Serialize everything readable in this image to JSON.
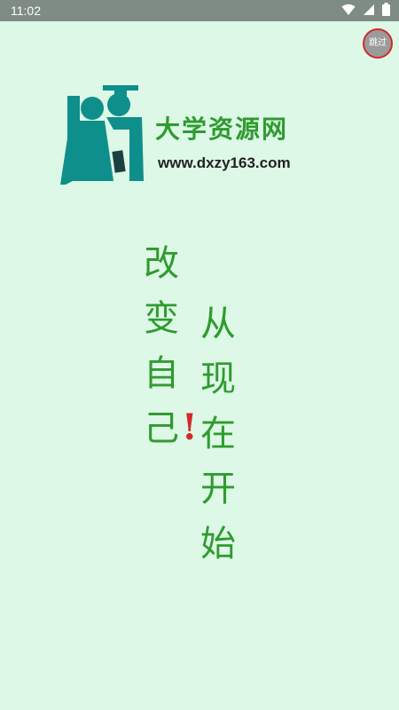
{
  "status_bar": {
    "time": "11:02",
    "icons": [
      "wifi-icon",
      "signal-icon",
      "battery-icon"
    ]
  },
  "skip_button": {
    "label": "跳过"
  },
  "brand": {
    "name": "大学资源网",
    "url": "www.dxzy163.com",
    "logo_colors": {
      "teal": "#0e8f8c",
      "dark": "#1c3f3f"
    }
  },
  "slogan": {
    "left_column": [
      "改",
      "变",
      "自",
      "己"
    ],
    "exclamation": "!",
    "right_column": [
      "从",
      "现",
      "在",
      "开",
      "始"
    ]
  },
  "colors": {
    "background": "#ddf8e6",
    "text_green": "#2f9b2f",
    "accent_red": "#d22a2a"
  }
}
